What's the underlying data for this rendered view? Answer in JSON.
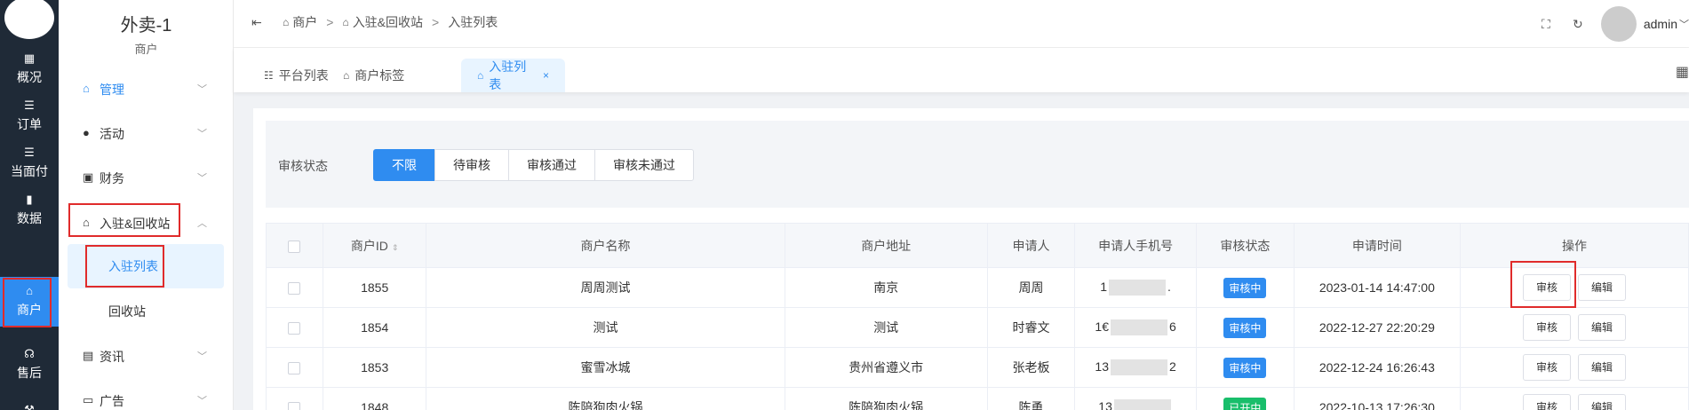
{
  "rail": {
    "items": [
      {
        "label": "概况",
        "icon": "dashboard-icon",
        "glyph": "▦"
      },
      {
        "label": "订单",
        "icon": "list-icon",
        "glyph": "☰"
      },
      {
        "label": "当面付",
        "icon": "list-icon",
        "glyph": "☰"
      },
      {
        "label": "数据",
        "icon": "bar-chart-icon",
        "glyph": "▮"
      },
      {
        "label": "商户",
        "icon": "store-icon",
        "glyph": "⌂"
      },
      {
        "label": "售后",
        "icon": "headset-icon",
        "glyph": "☊"
      }
    ]
  },
  "sidebar": {
    "title": "外卖-1",
    "subtitle": "商户",
    "items": [
      {
        "label": "管理",
        "glyph": "⌂"
      },
      {
        "label": "活动",
        "glyph": "●"
      },
      {
        "label": "财务",
        "glyph": "▣"
      },
      {
        "label": "入驻&回收站",
        "glyph": "⌂"
      },
      {
        "label": "资讯",
        "glyph": "▤"
      },
      {
        "label": "广告",
        "glyph": "▭"
      }
    ],
    "sub_items": [
      {
        "label": "入驻列表"
      },
      {
        "label": "回收站"
      }
    ]
  },
  "header": {
    "breadcrumb": [
      "商户",
      "入驻&回收站",
      "入驻列表"
    ],
    "user": "admin"
  },
  "tabs": [
    {
      "label": "平台列表"
    },
    {
      "label": "商户标签"
    },
    {
      "label": "入驻列表",
      "close": "×"
    }
  ],
  "filter": {
    "label": "审核状态",
    "options": [
      "不限",
      "待审核",
      "审核通过",
      "审核未通过"
    ],
    "selected": "不限"
  },
  "table": {
    "columns": [
      "商户ID",
      "商户名称",
      "商户地址",
      "申请人",
      "申请人手机号",
      "审核状态",
      "申请时间",
      "操作"
    ],
    "rows": [
      {
        "id": "1855",
        "name": "周周测试",
        "address": "南京",
        "applicant": "周周",
        "phone_head": "1",
        "phone_tail": ".",
        "status": "审核中",
        "time": "2023-01-14 14:47:00",
        "actions": [
          "审核",
          "编辑"
        ]
      },
      {
        "id": "1854",
        "name": "测试",
        "address": "测试",
        "applicant": "时睿文",
        "phone_head": "1€",
        "phone_tail": "6",
        "status": "审核中",
        "time": "2022-12-27 22:20:29",
        "actions": [
          "审核",
          "编辑"
        ]
      },
      {
        "id": "1853",
        "name": "蜜雪冰城",
        "address": "贵州省遵义市",
        "applicant": "张老板",
        "phone_head": "13",
        "phone_tail": "2",
        "status": "审核中",
        "time": "2022-12-24 16:26:43",
        "actions": [
          "审核",
          "编辑"
        ]
      },
      {
        "id": "1848",
        "name": "陈陪狗肉火锅",
        "address": "陈陪狗肉火锅",
        "applicant": "陈勇",
        "phone_head": "13",
        "phone_tail": "",
        "status": "已开中",
        "time": "2022-10-13 17:26:30",
        "actions": [
          "审核",
          "编辑"
        ]
      }
    ]
  },
  "colors": {
    "accent": "#2f8cf0",
    "rail_bg": "#1f2a37",
    "status_review": "#2f8cf0",
    "status_green": "#19be6b",
    "highlight_box": "#e02b2b"
  }
}
